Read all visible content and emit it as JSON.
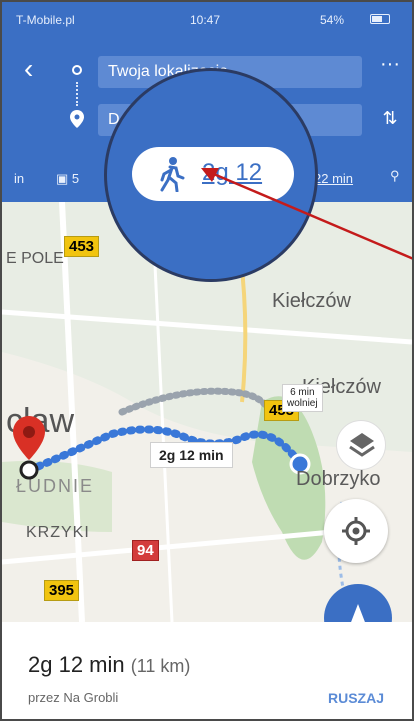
{
  "status_bar": {
    "carrier": "T-Mobile.pl",
    "time": "10:47",
    "battery": "54%"
  },
  "header": {
    "origin_text": "Twoja lokalizacja",
    "destination_text": "D",
    "more_icon": "more-horizontal-icon",
    "swap_icon": "swap-vertical-icon"
  },
  "modes": {
    "left_partial": "in",
    "transit_partial": "5",
    "walk_time": "2g 12",
    "bike_time": "22 min"
  },
  "map": {
    "labels": {
      "pole": "E POLE",
      "kielczow_top": "Kiełczów",
      "kielczow_mid": "Kiełczów",
      "wroclaw": "cław",
      "dobrzykow": "Dobrzyko",
      "poludnie": "ŁUDNIE",
      "krzyki": "KRZYKI"
    },
    "road_badges": {
      "r453": "453",
      "r455": "455",
      "r94": "94",
      "r395": "395"
    },
    "route_label": "2g 12 min",
    "alt_label_time": "6 min",
    "alt_label_sub": "wolniej"
  },
  "bottom": {
    "duration": "2g 12 min",
    "distance": "(11 km)",
    "via": "przez Na Grobli",
    "go_label": "RUSZAJ"
  },
  "colors": {
    "primary": "#3b6fc4",
    "route": "#3a78d8",
    "pin": "#d93025",
    "road_badge_yellow": "#f1c40f",
    "road_badge_red": "#d33b3b",
    "annotation_arrow": "#c41b1b"
  }
}
